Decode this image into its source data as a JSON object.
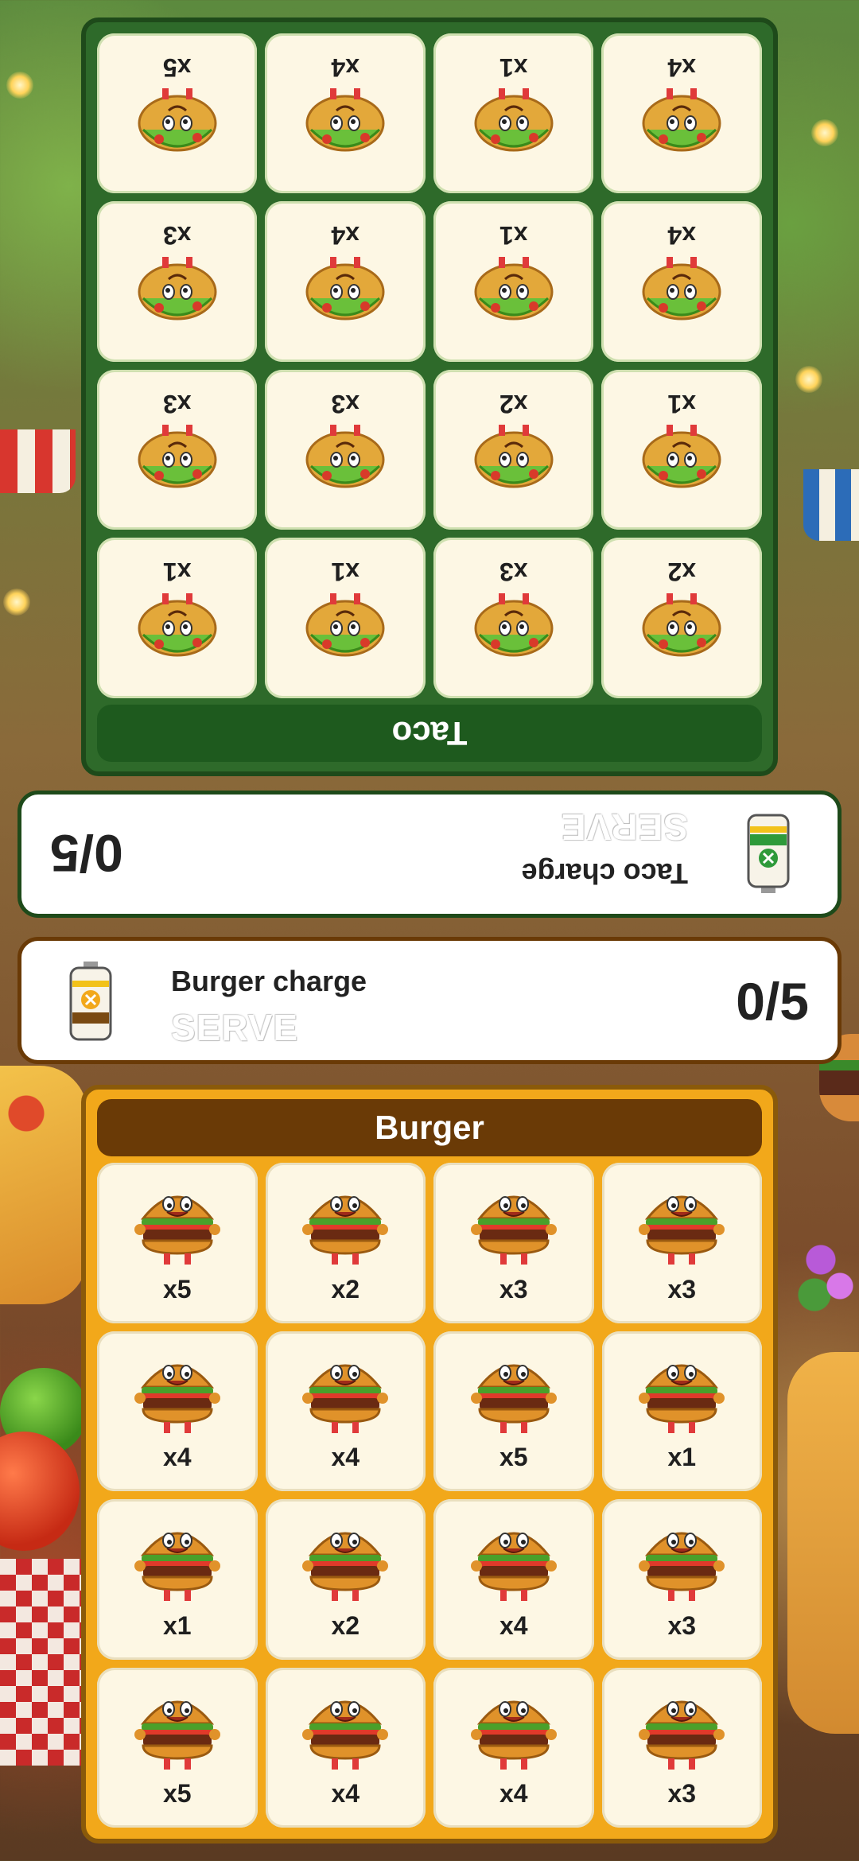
{
  "taco_board": {
    "title": "Taco",
    "cards": [
      {
        "count": "x2"
      },
      {
        "count": "x3"
      },
      {
        "count": "x1"
      },
      {
        "count": "x1"
      },
      {
        "count": "x1"
      },
      {
        "count": "x2"
      },
      {
        "count": "x3"
      },
      {
        "count": "x3"
      },
      {
        "count": "x4"
      },
      {
        "count": "x1"
      },
      {
        "count": "x4"
      },
      {
        "count": "x3"
      },
      {
        "count": "x4"
      },
      {
        "count": "x1"
      },
      {
        "count": "x4"
      },
      {
        "count": "x5"
      }
    ]
  },
  "taco_charge": {
    "label": "Taco charge",
    "serve_label": "SERVE",
    "progress": "0/5",
    "accent": "#2e9a3a"
  },
  "burger_charge": {
    "label": "Burger charge",
    "serve_label": "SERVE",
    "progress": "0/5",
    "accent": "#f2a81a"
  },
  "burger_board": {
    "title": "Burger",
    "cards": [
      {
        "count": "x5"
      },
      {
        "count": "x2"
      },
      {
        "count": "x3"
      },
      {
        "count": "x3"
      },
      {
        "count": "x4"
      },
      {
        "count": "x4"
      },
      {
        "count": "x5"
      },
      {
        "count": "x1"
      },
      {
        "count": "x1"
      },
      {
        "count": "x2"
      },
      {
        "count": "x4"
      },
      {
        "count": "x3"
      },
      {
        "count": "x5"
      },
      {
        "count": "x4"
      },
      {
        "count": "x4"
      },
      {
        "count": "x3"
      }
    ]
  },
  "icons": {
    "taco_card": "taco-mascot-icon",
    "burger_card": "burger-mascot-icon",
    "charge_can": "battery-can-icon"
  },
  "colors": {
    "taco_panel": "#2e6a2a",
    "burger_panel": "#f2a81a",
    "card_bg": "#fdf7e4"
  }
}
